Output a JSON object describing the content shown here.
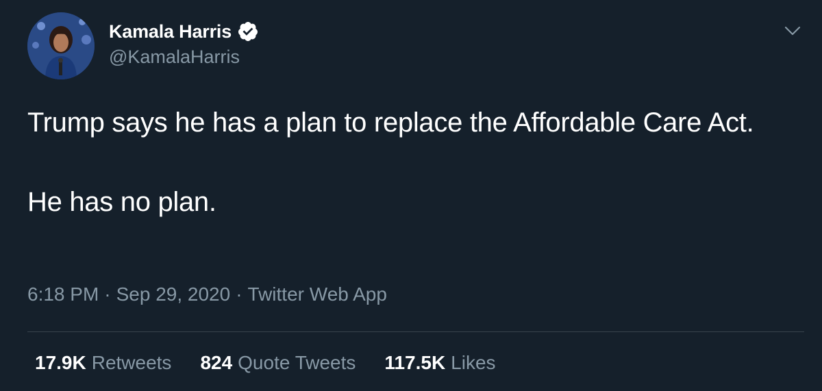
{
  "author": {
    "display_name": "Kamala Harris",
    "handle": "@KamalaHarris",
    "verified": true,
    "avatar_icon": "profile-photo"
  },
  "tweet": {
    "paragraphs": [
      "Trump says he has a plan to replace the Affordable Care Act.",
      "He has no plan."
    ]
  },
  "meta": {
    "time": "6:18 PM",
    "separator": "·",
    "date": "Sep 29, 2020",
    "source": "Twitter Web App"
  },
  "stats": [
    {
      "count": "17.9K",
      "label": "Retweets"
    },
    {
      "count": "824",
      "label": "Quote Tweets"
    },
    {
      "count": "117.5K",
      "label": "Likes"
    }
  ],
  "colors": {
    "background": "#15202b",
    "primary_text": "#ffffff",
    "secondary_text": "#8899a6",
    "divider": "#38444d",
    "verified_badge": "#ffffff"
  }
}
